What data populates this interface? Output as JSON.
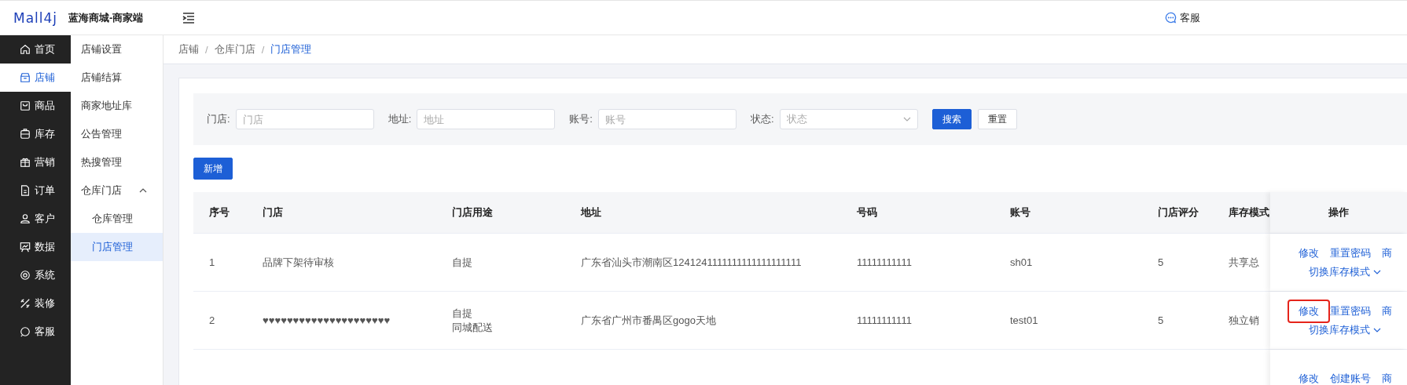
{
  "header": {
    "logo": "Mall4j",
    "title": "蓝海商城-商家端",
    "service": "客服"
  },
  "sidebar": {
    "items": [
      {
        "label": "首页",
        "selected": false
      },
      {
        "label": "店铺",
        "selected": true
      },
      {
        "label": "商品",
        "selected": false
      },
      {
        "label": "库存",
        "selected": false
      },
      {
        "label": "营销",
        "selected": false
      },
      {
        "label": "订单",
        "selected": false
      },
      {
        "label": "客户",
        "selected": false
      },
      {
        "label": "数据",
        "selected": false
      },
      {
        "label": "系统",
        "selected": false
      },
      {
        "label": "装修",
        "selected": false
      },
      {
        "label": "客服",
        "selected": false
      }
    ]
  },
  "submenu": {
    "items": [
      {
        "label": "店铺设置",
        "selected": false
      },
      {
        "label": "店铺结算",
        "selected": false
      },
      {
        "label": "商家地址库",
        "selected": false
      },
      {
        "label": "公告管理",
        "selected": false
      },
      {
        "label": "热搜管理",
        "selected": false
      },
      {
        "label": "仓库门店",
        "selected": false,
        "expanded": true,
        "children": [
          {
            "label": "仓库管理",
            "selected": false
          },
          {
            "label": "门店管理",
            "selected": true
          }
        ]
      }
    ]
  },
  "breadcrumb_separator": "/",
  "breadcrumb": [
    {
      "label": "店铺",
      "current": false
    },
    {
      "label": "仓库门店",
      "current": false
    },
    {
      "label": "门店管理",
      "current": true
    }
  ],
  "filters": [
    {
      "kind": "input",
      "label": "门店:",
      "placeholder": "门店"
    },
    {
      "kind": "input",
      "label": "地址:",
      "placeholder": "地址"
    },
    {
      "kind": "input",
      "label": "账号:",
      "placeholder": "账号"
    },
    {
      "kind": "select",
      "label": "状态:",
      "placeholder": "状态"
    }
  ],
  "filter_buttons": [
    {
      "label": "搜索",
      "primary": true
    },
    {
      "label": "重置",
      "primary": false
    }
  ],
  "add_button": "新增",
  "table": {
    "columns": [
      "序号",
      "门店",
      "门店用途",
      "地址",
      "号码",
      "账号",
      "门店评分",
      "库存模式",
      "操作"
    ],
    "rows": [
      {
        "cells": [
          "1",
          "品牌下架待审核",
          [
            "自提"
          ],
          "广东省汕头市潮南区1241241111111111111111111",
          "11111111111",
          "sh01",
          "5",
          "共享总"
        ],
        "actions": [
          [
            {
              "label": "修改",
              "highlighted": false
            },
            {
              "label": "重置密码",
              "highlighted": false
            },
            {
              "label": "商",
              "highlighted": false
            }
          ],
          [
            {
              "label": "切换库存模式",
              "highlighted": false,
              "dropdown": true
            }
          ]
        ]
      },
      {
        "cells": [
          "2",
          "♥♥♥♥♥♥♥♥♥♥♥♥♥♥♥♥♥♥♥♥♥",
          [
            "自提",
            "同城配送"
          ],
          "广东省广州市番禺区gogo天地",
          "11111111111",
          "test01",
          "5",
          "独立销"
        ],
        "actions": [
          [
            {
              "label": "修改",
              "highlighted": true
            },
            {
              "label": "重置密码",
              "highlighted": false
            },
            {
              "label": "商",
              "highlighted": false
            }
          ],
          [
            {
              "label": "切换库存模式",
              "highlighted": false,
              "dropdown": true
            }
          ]
        ]
      },
      {
        "cells": [],
        "actions": [
          [
            {
              "label": "修改",
              "highlighted": false
            },
            {
              "label": "创建账号",
              "highlighted": false
            },
            {
              "label": "商",
              "highlighted": false
            }
          ]
        ]
      }
    ]
  }
}
